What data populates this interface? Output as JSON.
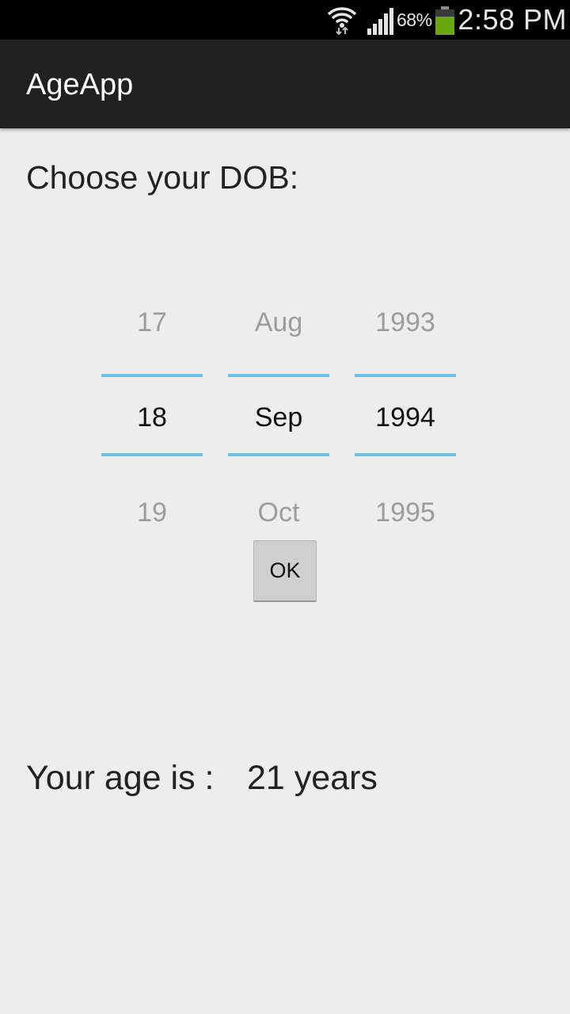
{
  "status_bar": {
    "battery_percent": "68%",
    "time": "2:58 PM",
    "icons": [
      "wifi-icon",
      "signal-icon",
      "battery-icon"
    ],
    "battery_color": "#6aa80f"
  },
  "action_bar": {
    "title": "AgeApp",
    "background_color": "#212121"
  },
  "content": {
    "prompt": "Choose your DOB:",
    "date_picker": {
      "day": {
        "prev": "17",
        "current": "18",
        "next": "19"
      },
      "month": {
        "prev": "Aug",
        "current": "Sep",
        "next": "Oct"
      },
      "year": {
        "prev": "1993",
        "current": "1994",
        "next": "1995"
      },
      "accent_color": "#6fc2e0"
    },
    "ok_label": "OK",
    "age_label": "Your age is :",
    "age_value": "21 years"
  }
}
